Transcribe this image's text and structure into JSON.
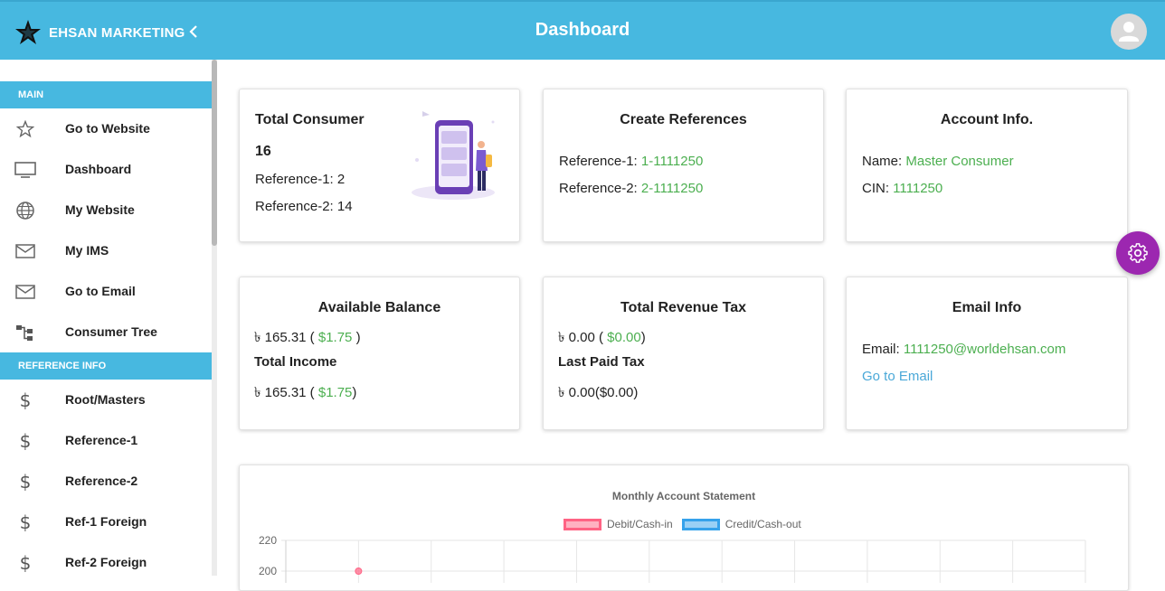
{
  "brand": {
    "name": "EHSAN MARKETING"
  },
  "header": {
    "title": "Dashboard"
  },
  "sidebar": {
    "sections": [
      {
        "label": "MAIN"
      },
      {
        "label": "REFERENCE INFO"
      }
    ],
    "items": [
      {
        "label": "Go to Website",
        "icon": "star-icon"
      },
      {
        "label": "Dashboard",
        "icon": "monitor-icon"
      },
      {
        "label": "My Website",
        "icon": "globe-icon"
      },
      {
        "label": "My IMS",
        "icon": "mail-icon"
      },
      {
        "label": "Go to Email",
        "icon": "mail-icon"
      },
      {
        "label": "Consumer Tree",
        "icon": "tree-icon"
      },
      {
        "label": "Root/Masters",
        "icon": "dollar-icon"
      },
      {
        "label": "Reference-1",
        "icon": "dollar-icon"
      },
      {
        "label": "Reference-2",
        "icon": "dollar-icon"
      },
      {
        "label": "Ref-1 Foreign",
        "icon": "dollar-icon"
      },
      {
        "label": "Ref-2 Foreign",
        "icon": "dollar-icon"
      }
    ]
  },
  "cards": {
    "total_consumer": {
      "title": "Total Consumer",
      "count": "16",
      "ref1_label": "Reference-1: 2",
      "ref2_label": "Reference-2: 14"
    },
    "create_references": {
      "title": "Create References",
      "ref1_label": "Reference-1: ",
      "ref1_value": "1-1111250",
      "ref2_label": "Reference-2: ",
      "ref2_value": "2-1111250"
    },
    "account_info": {
      "title": "Account Info.",
      "name_label": "Name: ",
      "name_value": "Master Consumer",
      "cin_label": "CIN: ",
      "cin_value": "1111250"
    },
    "available_balance": {
      "title": "Available Balance",
      "balance_prefix": "৳ 165.31 ( ",
      "balance_usd": "$1.75",
      "balance_suffix": " )",
      "income_title": "Total Income",
      "income_prefix": "৳ 165.31 ( ",
      "income_usd": "$1.75",
      "income_suffix": ")"
    },
    "revenue_tax": {
      "title": "Total Revenue Tax",
      "tax_prefix": "৳ 0.00 ( ",
      "tax_usd": "$0.00",
      "tax_suffix": ")",
      "last_paid_title": "Last Paid Tax",
      "last_paid_value": "৳ 0.00($0.00)"
    },
    "email_info": {
      "title": "Email Info",
      "email_label": "Email: ",
      "email_value": "1111250@worldehsan.com",
      "go_to_email": "Go to Email"
    }
  },
  "colors": {
    "header": "#47b8e0",
    "accent_green": "#4caf50",
    "link": "#4aa8d8",
    "fab": "#9c27b0",
    "debit": "#ff6384",
    "credit": "#36a2eb"
  },
  "chart_data": {
    "type": "line",
    "title": "Monthly Account Statement",
    "series": [
      {
        "name": "Debit/Cash-in",
        "values": [
          200
        ]
      },
      {
        "name": "Credit/Cash-out",
        "values": []
      }
    ],
    "y_ticks": [
      "220",
      "200"
    ],
    "ylim": [
      200,
      220
    ],
    "grid": true,
    "legend_position": "top"
  }
}
